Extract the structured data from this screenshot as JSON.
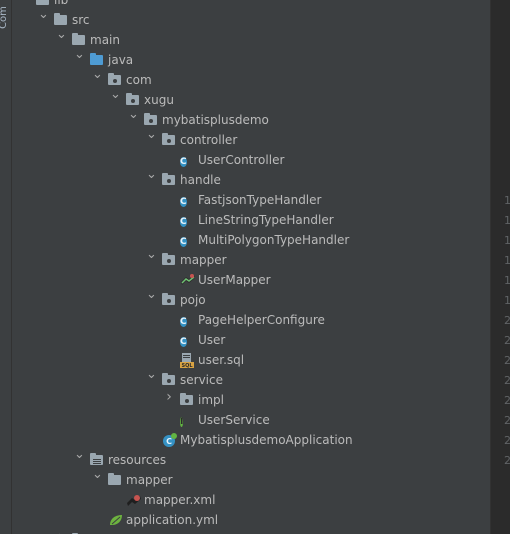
{
  "sidebar": {
    "label": "Com"
  },
  "tree": {
    "rows": [
      {
        "id": "lib",
        "label": "lib",
        "indent": 0,
        "arrow": "right",
        "icon": "folder-gray"
      },
      {
        "id": "src",
        "label": "src",
        "indent": 1,
        "arrow": "down",
        "icon": "folder-gray"
      },
      {
        "id": "main",
        "label": "main",
        "indent": 2,
        "arrow": "down",
        "icon": "folder-gray"
      },
      {
        "id": "java",
        "label": "java",
        "indent": 3,
        "arrow": "down",
        "icon": "folder-blue"
      },
      {
        "id": "com",
        "label": "com",
        "indent": 4,
        "arrow": "down",
        "icon": "package"
      },
      {
        "id": "xugu",
        "label": "xugu",
        "indent": 5,
        "arrow": "down",
        "icon": "package"
      },
      {
        "id": "mybatisplusdemo",
        "label": "mybatisplusdemo",
        "indent": 6,
        "arrow": "down",
        "icon": "package"
      },
      {
        "id": "controller",
        "label": "controller",
        "indent": 7,
        "arrow": "down",
        "icon": "package"
      },
      {
        "id": "UserController",
        "label": "UserController",
        "indent": 8,
        "arrow": "none",
        "icon": "class"
      },
      {
        "id": "handle",
        "label": "handle",
        "indent": 7,
        "arrow": "down",
        "icon": "package"
      },
      {
        "id": "FastjsonTypeHandler",
        "label": "FastjsonTypeHandler",
        "indent": 8,
        "arrow": "none",
        "icon": "class"
      },
      {
        "id": "LineStringTypeHandler",
        "label": "LineStringTypeHandler",
        "indent": 8,
        "arrow": "none",
        "icon": "class"
      },
      {
        "id": "MultiPolygonTypeHandler",
        "label": "MultiPolygonTypeHandler",
        "indent": 8,
        "arrow": "none",
        "icon": "class"
      },
      {
        "id": "mapper",
        "label": "mapper",
        "indent": 7,
        "arrow": "down",
        "icon": "package"
      },
      {
        "id": "UserMapper",
        "label": "UserMapper",
        "indent": 8,
        "arrow": "none",
        "icon": "mapper"
      },
      {
        "id": "pojo",
        "label": "pojo",
        "indent": 7,
        "arrow": "down",
        "icon": "package"
      },
      {
        "id": "PageHelperConfigure",
        "label": "PageHelperConfigure",
        "indent": 8,
        "arrow": "none",
        "icon": "class"
      },
      {
        "id": "User",
        "label": "User",
        "indent": 8,
        "arrow": "none",
        "icon": "class"
      },
      {
        "id": "user_sql",
        "label": "user.sql",
        "indent": 8,
        "arrow": "none",
        "icon": "sql"
      },
      {
        "id": "service",
        "label": "service",
        "indent": 7,
        "arrow": "down",
        "icon": "package"
      },
      {
        "id": "impl",
        "label": "impl",
        "indent": 8,
        "arrow": "right",
        "icon": "package"
      },
      {
        "id": "UserService",
        "label": "UserService",
        "indent": 8,
        "arrow": "none",
        "icon": "interface"
      },
      {
        "id": "MybatisplusdemoApplication",
        "label": "MybatisplusdemoApplication",
        "indent": 7,
        "arrow": "none",
        "icon": "spring-class"
      },
      {
        "id": "resources",
        "label": "resources",
        "indent": 3,
        "arrow": "down",
        "icon": "folder-res"
      },
      {
        "id": "res_mapper",
        "label": "mapper",
        "indent": 4,
        "arrow": "down",
        "icon": "folder-gray"
      },
      {
        "id": "mapper_xml",
        "label": "mapper.xml",
        "indent": 5,
        "arrow": "none",
        "icon": "xml-mybatis"
      },
      {
        "id": "application_yml",
        "label": "application.yml",
        "indent": 4,
        "arrow": "none",
        "icon": "yml"
      },
      {
        "id": "test",
        "label": "",
        "indent": 2,
        "arrow": "right",
        "icon": "folder-gray"
      }
    ]
  },
  "gutter": {
    "numbers": [
      "1",
      "1",
      "1",
      "1",
      "1",
      "1",
      "2",
      "2",
      "2",
      "2",
      "2",
      "2",
      "2",
      "2"
    ]
  },
  "colors": {
    "background": "#3c3f41",
    "text": "#bbbbbb",
    "class_icon": "#3592c4",
    "interface_icon": "#62b543",
    "source_folder": "#4e9bd3"
  }
}
